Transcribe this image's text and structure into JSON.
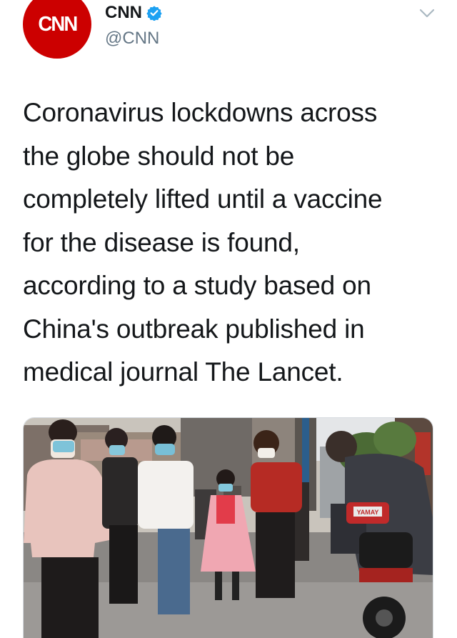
{
  "author": {
    "avatar_text": "CNN",
    "display_name": "CNN",
    "handle": "@CNN",
    "verified": true,
    "verified_icon": "verified-badge-icon",
    "brand_color": "#cc0000",
    "verified_color": "#1da1f2"
  },
  "menu": {
    "icon": "chevron-down-icon"
  },
  "tweet": {
    "text": "Coronavirus lockdowns across\nthe globe should not be\ncompletely lifted until a vaccine\nfor the disease is found,\naccording to a study based on\nChina's outbreak published in\nmedical journal The Lancet."
  },
  "media": {
    "type": "photo",
    "sign_text": "YAMAY"
  }
}
